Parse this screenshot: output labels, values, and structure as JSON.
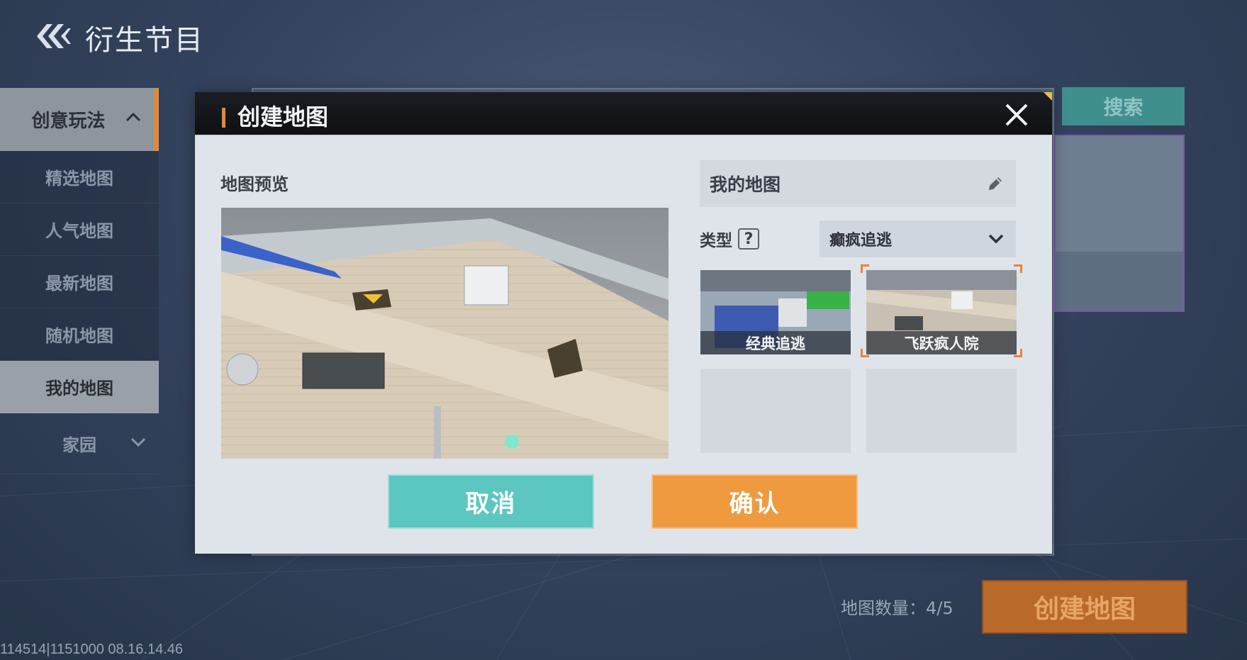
{
  "header": {
    "title": "衍生节目"
  },
  "sidebar": {
    "section_label": "创意玩法",
    "items": [
      {
        "label": "精选地图",
        "active": false
      },
      {
        "label": "人气地图",
        "active": false
      },
      {
        "label": "最新地图",
        "active": false
      },
      {
        "label": "随机地图",
        "active": false
      },
      {
        "label": "我的地图",
        "active": true
      }
    ],
    "home_label": "家园"
  },
  "background": {
    "search_label": "搜索",
    "map_count_label": "地图数量：",
    "map_count_value": "4/5",
    "create_map_label": "创建地图",
    "version_text": "114514|1151000 08.16.14.46"
  },
  "modal": {
    "title": "创建地图",
    "preview_label": "地图预览",
    "name_value": "我的地图",
    "type_label": "类型",
    "type_help": "?",
    "type_selected": "癫疯追逃",
    "templates": [
      {
        "label": "经典追逃",
        "selected": false
      },
      {
        "label": "飞跃疯人院",
        "selected": true
      }
    ],
    "cancel_label": "取消",
    "confirm_label": "确认"
  },
  "colors": {
    "accent_orange": "#ef9a3f",
    "accent_teal": "#5cc6c1",
    "header_dark": "#0e1013"
  }
}
